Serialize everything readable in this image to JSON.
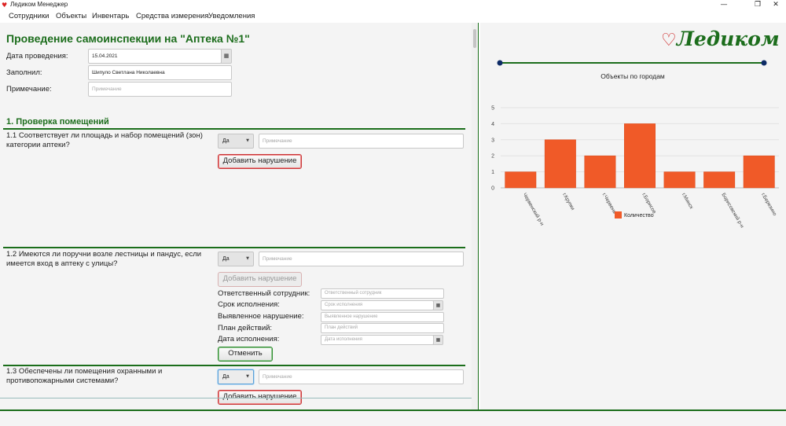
{
  "window": {
    "title": "Ледиком Менеджер",
    "icon": "ledikom-app-icon"
  },
  "menu": [
    "Сотрудники",
    "Объекты",
    "Инвентарь",
    "Средства измерения",
    "Уведомления"
  ],
  "form": {
    "title": "Проведение самоинспекции на \"Аптека №1\"",
    "date_label": "Дата проведения:",
    "date_value": "15.04.2021",
    "filled_label": "Заполнил:",
    "filled_value": "Шипуло Светлана Николаевна",
    "note_label": "Примечание:",
    "note_placeholder": "Примечание"
  },
  "section": {
    "title": "1. Проверка помещений"
  },
  "questions": [
    {
      "text": "1.1 Соответствует ли площадь и набор помещений (зон) категории аптеки?",
      "answer": "Да",
      "note_placeholder": "Примечание",
      "add_label": "Добавить нарушение"
    },
    {
      "text": "1.2 Имеются ли поручни возле лестницы и пандус, если имеется вход в аптеку с улицы?",
      "answer": "Да",
      "note_placeholder": "Примечание",
      "add_label": "Добавить нарушение",
      "violation": {
        "responsible_label": "Ответственный сотрудник:",
        "responsible_placeholder": "Ответственный сотрудник",
        "deadline_label": "Срок исполнения:",
        "deadline_placeholder": "Срок исполнения",
        "found_label": "Выявленное нарушение:",
        "found_placeholder": "Выявленное нарушение",
        "plan_label": "План действий:",
        "plan_placeholder": "План действий",
        "done_label": "Дата исполнения:",
        "done_placeholder": "Дата исполнения",
        "cancel_label": "Отменить"
      }
    },
    {
      "text": "1.3 Обеспечены ли помещения охранными и противопожарными системами?",
      "answer": "Да",
      "note_placeholder": "Примечание",
      "add_label": "Добавить нарушение"
    }
  ],
  "logo": {
    "text": "Ледиком",
    "icon": "heart-logo-icon"
  },
  "chart_data": {
    "type": "bar",
    "title": "Объекты по городам",
    "categories": [
      "Червенский р-н",
      "г.Крупки",
      "г.Червень",
      "г.Борисов",
      "г.Минск",
      "Борисовский р-н",
      "г.Березино"
    ],
    "series": [
      {
        "name": "Количество",
        "values": [
          1,
          3,
          2,
          4,
          1,
          1,
          2
        ]
      }
    ],
    "ylim": [
      0,
      5
    ],
    "yticks": [
      0,
      1,
      2,
      3,
      4,
      5
    ],
    "grid": true,
    "legend": "bottom",
    "bar_color": "#f05a28"
  },
  "colors": {
    "accent": "#1c6d1c",
    "bar": "#f05a28",
    "slider": "#0d2b66"
  }
}
